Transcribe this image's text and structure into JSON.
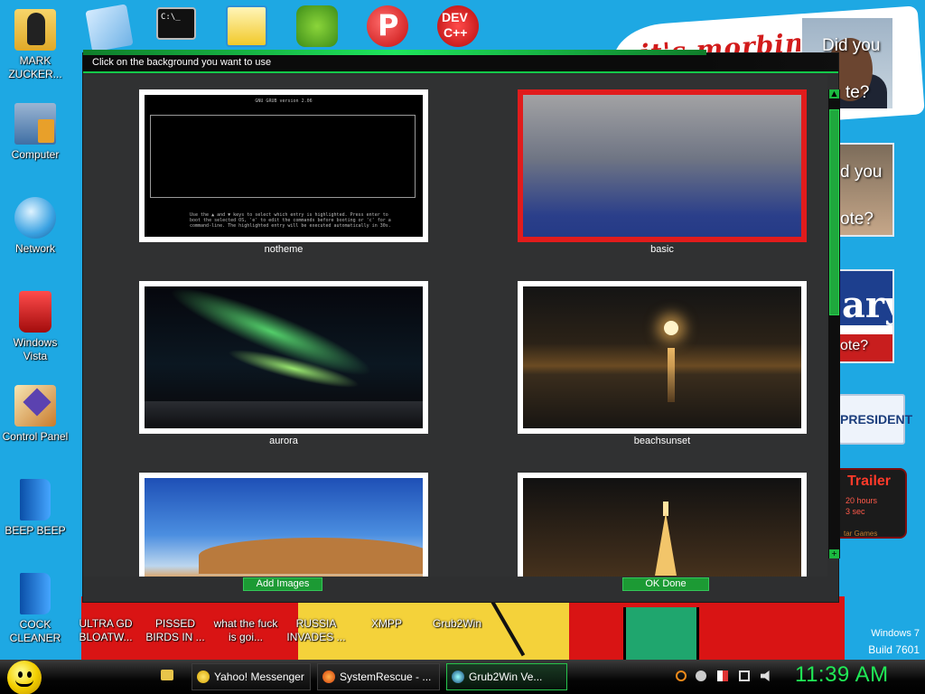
{
  "wallpaper": {
    "banner_text": "it's morbin t",
    "photo1_line1": "Did you",
    "photo1_line2": "te?",
    "photo2_line1": "d you",
    "photo2_line2": "ote?",
    "photo3_big": "ary",
    "photo3_line2": "ote?",
    "president": "PRESIDENT",
    "trailer_title": "Trailer",
    "trailer_l1": "20 hours",
    "trailer_l2": "3 sec",
    "trailer_l3": "tar Games",
    "watermark_line1": "Windows 7",
    "watermark_line2": "Build 7601"
  },
  "desktop_icons": [
    {
      "label": "MARK ZUCKER..."
    },
    {
      "label": "Computer"
    },
    {
      "label": "Network"
    },
    {
      "label": "Windows Vista"
    },
    {
      "label": "Control Panel"
    },
    {
      "label": "BEEP BEEP"
    },
    {
      "label": "COCK CLEANER"
    }
  ],
  "desktop_row_bottom": [
    {
      "label": "ULTRA GD BLOATW..."
    },
    {
      "label": "PISSED BIRDS IN ..."
    },
    {
      "label": "what the fuck is goi..."
    },
    {
      "label": "RUSSIA INVADES ..."
    },
    {
      "label": "XMPP"
    },
    {
      "label": "Grub2Win"
    }
  ],
  "desktop_top_icons": {
    "devcpp_text1": "DEV",
    "devcpp_text2": "C++",
    "cmd_text": "C:\\_"
  },
  "dialog": {
    "title": "Click on the background you want to use",
    "thumbnails": [
      {
        "label": "notheme",
        "selected": false
      },
      {
        "label": "basic",
        "selected": true
      },
      {
        "label": "aurora",
        "selected": false
      },
      {
        "label": "beachsunset",
        "selected": false
      },
      {
        "label": "",
        "selected": false
      },
      {
        "label": "",
        "selected": false
      }
    ],
    "grub_preview": {
      "header": "GNU GRUB  version 2.06",
      "help": "Use the ▲ and ▼ keys to select which entry is highlighted. Press enter to boot the selected OS, 'e' to edit the commands before booting or 'c' for a command-line. The highlighted entry will be executed automatically in 30s."
    },
    "add_images_label": "Add Images",
    "ok_done_label": "OK Done",
    "scroll_up": "▲",
    "scroll_down": "+"
  },
  "taskbar": {
    "tasks": [
      {
        "label": "Yahoo! Messenger",
        "active": false
      },
      {
        "label": "SystemRescue - ...",
        "active": false
      },
      {
        "label": "Grub2Win    Ve...",
        "active": true
      }
    ],
    "clock": "11:39 AM"
  },
  "colors": {
    "accent_green": "#1ee55c",
    "selected_border": "#e11c1c",
    "dialog_bg": "#2e2f30",
    "clock_color": "#20e856"
  }
}
